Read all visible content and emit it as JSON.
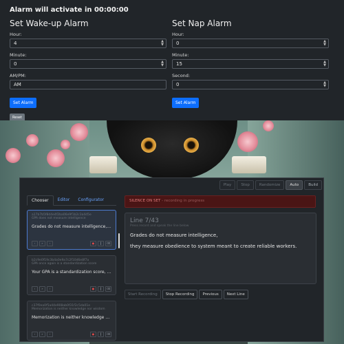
{
  "alarm_status": "Alarm will activate in 00:00:00",
  "wakeup": {
    "title": "Set Wake-up Alarm",
    "hour_label": "Hour:",
    "hour_value": "4",
    "minute_label": "Minute:",
    "minute_value": "0",
    "ampm_label": "AM/PM:",
    "ampm_value": "AM",
    "set_button": "Set Alarm",
    "reset_button": "Reset"
  },
  "nap": {
    "title": "Set Nap Alarm",
    "hour_label": "Hour:",
    "hour_value": "0",
    "minute_label": "Minute:",
    "minute_value": "15",
    "second_label": "Second:",
    "second_value": "0",
    "set_button": "Set Alarm"
  },
  "player": {
    "top_buttons": [
      "Play",
      "Stop",
      "Randomize",
      "Auto",
      "Build"
    ],
    "tabs": [
      "Chooser",
      "Editor",
      "Configurator"
    ],
    "cards": [
      {
        "id": "a17b7b5f8d4e4f2ba06e9f1b2c3a4d5e",
        "sub": "GPA does not measure intelligence",
        "text": "Grades do not measure intelligence, they m..."
      },
      {
        "id": "b2c9e0f19c3b4a0e9a7c2f10d6e8f7a",
        "sub": "GPA once again is a standardization score",
        "text": "Your GPA is a standardization score, not a ..."
      },
      {
        "id": "c37f0ea0f5a44e908ab0f31f2c5da01e",
        "sub": "Memorization is neither knowledge nor wisdom",
        "text": "Memorization is neither knowledge nor wis..."
      }
    ],
    "banner": "SILENCE ON SET",
    "banner_hint": "- recording in progress",
    "line_number": "Line 7/43",
    "line_hint": "Press record and speak the line below",
    "line_text_1": "Grades do not measure intelligence,",
    "line_text_2": "they measure obedience to system meant to create reliable workers.",
    "controls": [
      "Start Recording",
      "Stop Recording",
      "Previous",
      "Next Line"
    ]
  }
}
